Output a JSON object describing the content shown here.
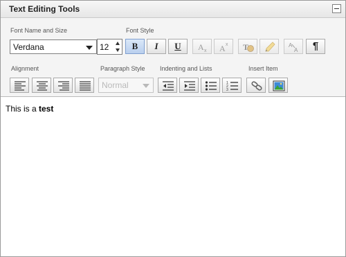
{
  "panel": {
    "title": "Text Editing Tools",
    "collapse_icon": "minus-icon"
  },
  "groups": {
    "font_name_size": "Font Name and Size",
    "font_style": "Font Style",
    "alignment": "Alignment",
    "paragraph_style": "Paragraph Style",
    "indenting_lists": "Indenting and Lists",
    "insert_item": "Insert Item"
  },
  "font": {
    "name": "Verdana",
    "size": "12"
  },
  "font_style_buttons": {
    "bold": "B",
    "italic": "I",
    "underline": "U",
    "subscript_icon": "subscript-icon",
    "superscript_icon": "superscript-icon",
    "text_color_icon": "text-color-icon",
    "highlight_icon": "highlight-icon",
    "change_case_icon": "change-case-icon",
    "show_formatting": "¶"
  },
  "paragraph": {
    "value": "Normal"
  },
  "editor": {
    "text_plain": "This is a ",
    "text_bold": "test"
  }
}
